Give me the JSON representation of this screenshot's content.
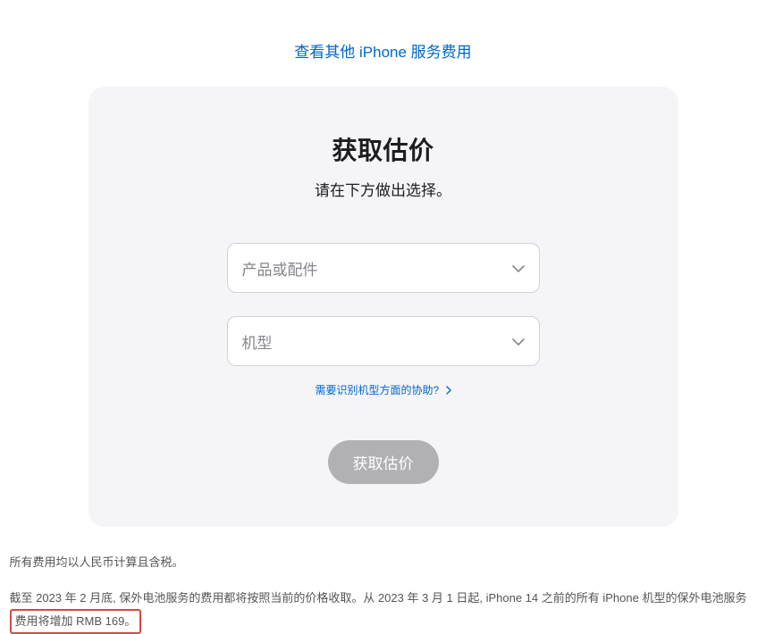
{
  "top_link": "查看其他 iPhone 服务费用",
  "card": {
    "title": "获取估价",
    "subtitle": "请在下方做出选择。",
    "select_product_placeholder": "产品或配件",
    "select_model_placeholder": "机型",
    "help_link": "需要识别机型方面的协助?",
    "submit_label": "获取估价"
  },
  "footnotes": {
    "line1": "所有费用均以人民币计算且含税。",
    "line2_pre": "截至 2023 年 2 月底, 保外电池服务的费用都将按照当前的价格收取。从 2023 年 3 月 1 日起, iPhone 14 之前的所有 iPhone 机型的保外电池服务",
    "line2_highlight": "费用将增加 RMB 169。"
  }
}
